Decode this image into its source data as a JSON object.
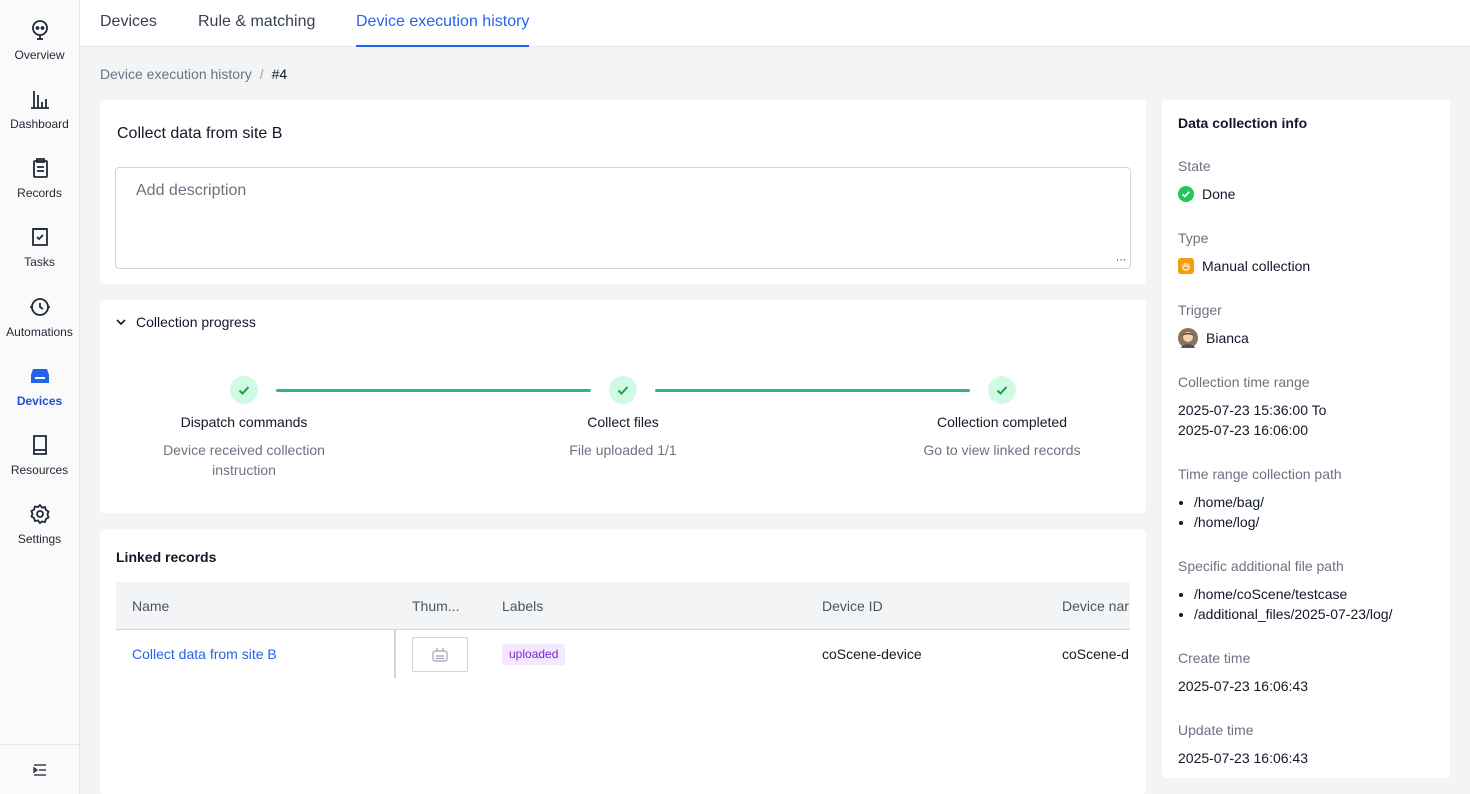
{
  "sidebar": {
    "items": [
      {
        "label": "Overview",
        "icon": "overview-icon"
      },
      {
        "label": "Dashboard",
        "icon": "dashboard-icon"
      },
      {
        "label": "Records",
        "icon": "records-icon"
      },
      {
        "label": "Tasks",
        "icon": "tasks-icon"
      },
      {
        "label": "Automations",
        "icon": "automations-icon"
      },
      {
        "label": "Devices",
        "icon": "devices-icon",
        "active": true
      },
      {
        "label": "Resources",
        "icon": "resources-icon"
      },
      {
        "label": "Settings",
        "icon": "gear-icon"
      }
    ],
    "collapse_icon": "collapse-sidebar-icon"
  },
  "tabs": [
    {
      "label": "Devices"
    },
    {
      "label": "Rule & matching"
    },
    {
      "label": "Device execution history",
      "active": true
    }
  ],
  "breadcrumb": {
    "parent": "Device execution history",
    "separator": "/",
    "current": "#4"
  },
  "record": {
    "title": "Collect data from site B",
    "description_placeholder": "Add description"
  },
  "progress": {
    "heading": "Collection progress",
    "steps": [
      {
        "title": "Dispatch commands",
        "desc_line1": "Device received collection",
        "desc_line2": "instruction"
      },
      {
        "title": "Collect files",
        "desc_line1": "File uploaded 1/1",
        "desc_line2": ""
      },
      {
        "title": "Collection completed",
        "desc_line1": "Go to view linked records",
        "desc_line2": ""
      }
    ],
    "accent": "#34b37e"
  },
  "linked": {
    "title": "Linked records",
    "columns": {
      "name": "Name",
      "thumb": "Thum...",
      "labels": "Labels",
      "device_id": "Device ID",
      "device_name": "Device nar"
    },
    "rows": [
      {
        "name": "Collect data from site B",
        "label": "uploaded",
        "device_id": "coScene-device",
        "device_name": "coScene-d"
      }
    ]
  },
  "info": {
    "title": "Data collection info",
    "state_label": "State",
    "state_value": "Done",
    "type_label": "Type",
    "type_value": "Manual collection",
    "trigger_label": "Trigger",
    "trigger_value": "Bianca",
    "range_label": "Collection time range",
    "range_line1": "2025-07-23 15:36:00 To",
    "range_line2": "2025-07-23 16:06:00",
    "path_label": "Time range collection path",
    "paths": [
      "/home/bag/",
      "/home/log/"
    ],
    "extra_label": "Specific additional file path",
    "extra_paths": [
      "/home/coScene/testcase",
      "/additional_files/2025-07-23/log/"
    ],
    "create_label": "Create time",
    "create_value": "2025-07-23 16:06:43",
    "update_label": "Update time",
    "update_value": "2025-07-23 16:06:43"
  }
}
